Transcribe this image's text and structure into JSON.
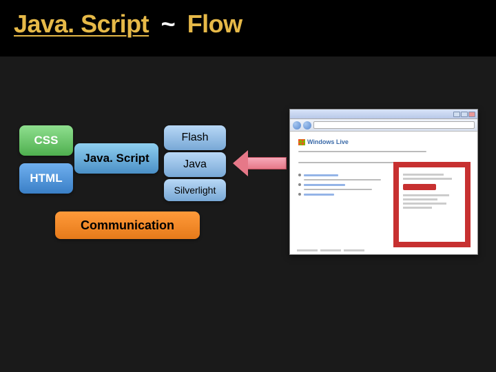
{
  "header": {
    "title_part1": "Java. Script",
    "title_sep": "~",
    "title_part2": "Flow"
  },
  "blocks": {
    "css": "CSS",
    "html": "HTML",
    "javascript": "Java. Script",
    "flash": "Flash",
    "java": "Java",
    "silverlight": "Silverlight",
    "communication": "Communication"
  },
  "browser": {
    "logo_text": "Windows Live"
  }
}
